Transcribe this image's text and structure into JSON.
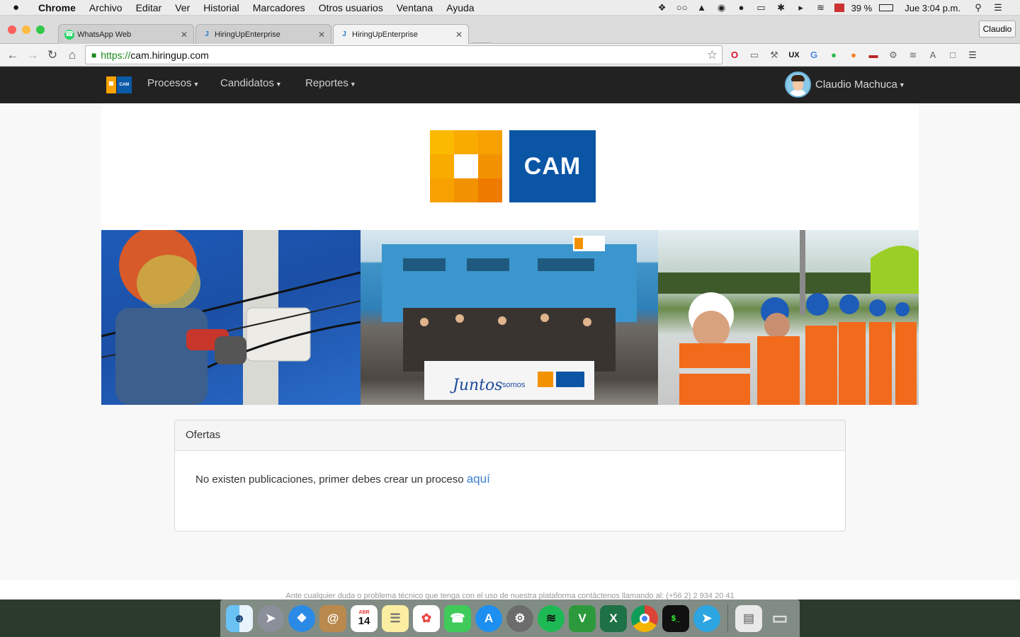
{
  "menubar": {
    "apple": "",
    "app": "Chrome",
    "items": [
      "Archivo",
      "Editar",
      "Ver",
      "Historial",
      "Marcadores",
      "Otros usuarios",
      "Ventana",
      "Ayuda"
    ],
    "battery": "39 %",
    "clock": "Jue 3:04 p.m."
  },
  "tabs": [
    {
      "title": "WhatsApp Web",
      "icon": "whatsapp-icon",
      "active": false
    },
    {
      "title": "HiringUpEnterprise",
      "icon": "hiringup-icon",
      "active": false
    },
    {
      "title": "HiringUpEnterprise",
      "icon": "hiringup-icon",
      "active": true
    }
  ],
  "profile_button": "Claudio",
  "address": {
    "scheme": "https://",
    "host": "cam.hiringup.com"
  },
  "sitenav": {
    "items": [
      "Procesos",
      "Candidatos",
      "Reportes"
    ],
    "user": "Claudio Machuca"
  },
  "logo": {
    "text": "CAM"
  },
  "panel": {
    "title": "Ofertas",
    "message": "No existen publicaciones, primer debes crear un proceso",
    "link": "aquí"
  },
  "footer": "Ante cualquier duda o problema técnico que tenga con el uso de nuestra plataforma contáctenos llamando al: (+56 2) 2 934 20 41",
  "banner": {
    "images": [
      "lineman-on-pole-photo",
      "team-group-photo",
      "workers-thumbs-up-photo"
    ],
    "sign_text": "Juntos somos CAM"
  },
  "dock": [
    "finder",
    "launchpad",
    "safari",
    "contacts",
    "calendar",
    "notes",
    "photos",
    "messages",
    "app-store",
    "system-preferences",
    "spotify",
    "vim",
    "excel",
    "chrome",
    "terminal",
    "telegram",
    "files",
    "trash"
  ],
  "calendar": {
    "month": "ABR",
    "day": "14"
  },
  "colors": {
    "brand_orange": "#f7a300",
    "brand_blue": "#0b55a5",
    "navbar": "#222222",
    "link": "#3a7fd0"
  }
}
